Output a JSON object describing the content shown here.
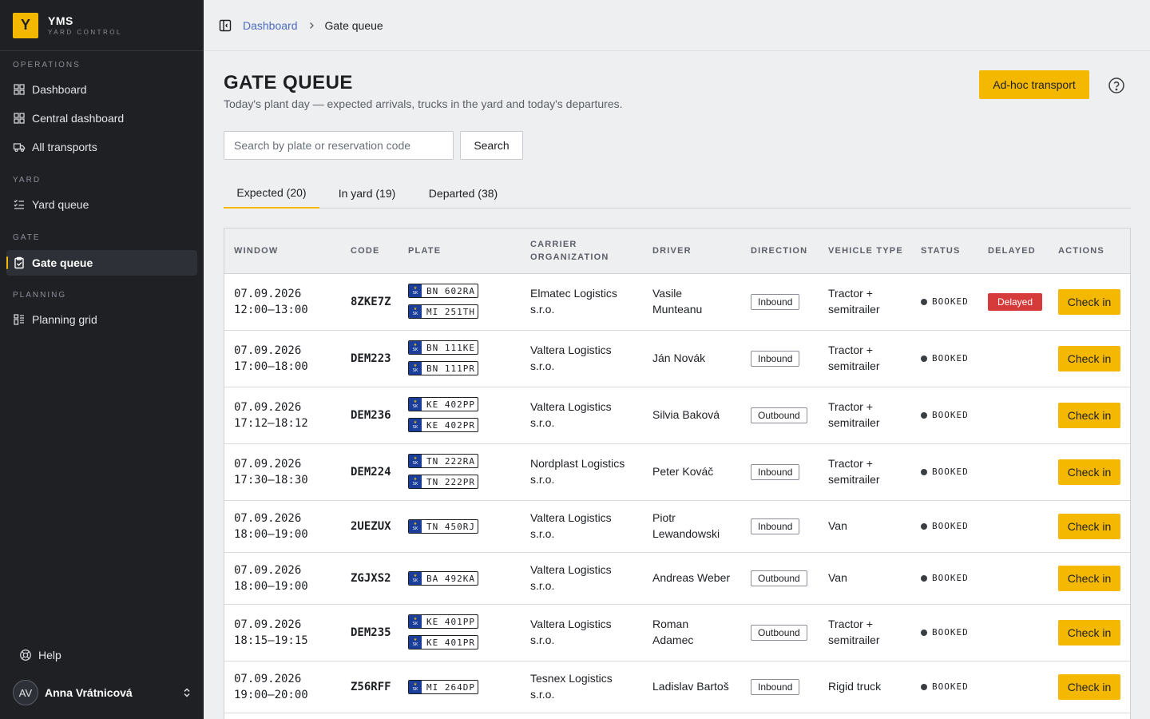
{
  "brand": {
    "logo": "Y",
    "name": "YMS",
    "subtitle": "YARD CONTROL",
    "accent": "#f5b800"
  },
  "sidebar": {
    "sections": [
      {
        "label": "OPERATIONS",
        "items": [
          {
            "label": "Dashboard",
            "icon": "grid-icon"
          },
          {
            "label": "Central dashboard",
            "icon": "grid-icon"
          },
          {
            "label": "All transports",
            "icon": "truck-icon"
          }
        ]
      },
      {
        "label": "YARD",
        "items": [
          {
            "label": "Yard queue",
            "icon": "list-check-icon"
          }
        ]
      },
      {
        "label": "GATE",
        "items": [
          {
            "label": "Gate queue",
            "icon": "clipboard-check-icon",
            "active": true
          }
        ]
      },
      {
        "label": "PLANNING",
        "items": [
          {
            "label": "Planning grid",
            "icon": "layout-icon"
          }
        ]
      }
    ],
    "help": "Help",
    "user": {
      "initials": "AV",
      "name": "Anna Vrátnicová"
    }
  },
  "breadcrumb": {
    "parent": "Dashboard",
    "current": "Gate queue"
  },
  "page": {
    "title": "GATE QUEUE",
    "subtitle": "Today's plant day — expected arrivals, trucks in the yard and today's departures.",
    "adhoc_label": "Ad-hoc transport"
  },
  "search": {
    "placeholder": "Search by plate or reservation code",
    "value": "",
    "button": "Search"
  },
  "tabs": [
    {
      "label": "Expected (20)",
      "active": true
    },
    {
      "label": "In yard (19)"
    },
    {
      "label": "Departed (38)"
    }
  ],
  "table": {
    "headers": {
      "window": "WINDOW",
      "code": "CODE",
      "plate": "PLATE",
      "carrier_1": "CARRIER",
      "carrier_2": "ORGANIZATION",
      "driver": "DRIVER",
      "direction": "DIRECTION",
      "vehicle": "VEHICLE TYPE",
      "status": "STATUS",
      "delayed": "DELAYED",
      "actions": "ACTIONS"
    },
    "plate_country": "SK",
    "rows": [
      {
        "date": "07.09.2026",
        "time": "12:00–13:00",
        "code": "8ZKE7Z",
        "plates": [
          "BN 602RA",
          "MI 251TH"
        ],
        "carrier_1": "Elmatec Logistics",
        "carrier_2": "s.r.o.",
        "driver_1": "Vasile",
        "driver_2": "Munteanu",
        "direction": "Inbound",
        "vehicle_1": "Tractor +",
        "vehicle_2": "semitrailer",
        "status": "BOOKED",
        "delayed": "Delayed",
        "action": "Check in"
      },
      {
        "date": "07.09.2026",
        "time": "17:00–18:00",
        "code": "DEM223",
        "plates": [
          "BN 111KE",
          "BN 111PR"
        ],
        "carrier_1": "Valtera Logistics",
        "carrier_2": "s.r.o.",
        "driver_1": "Ján Novák",
        "driver_2": "",
        "direction": "Inbound",
        "vehicle_1": "Tractor +",
        "vehicle_2": "semitrailer",
        "status": "BOOKED",
        "delayed": "",
        "action": "Check in"
      },
      {
        "date": "07.09.2026",
        "time": "17:12–18:12",
        "code": "DEM236",
        "plates": [
          "KE 402PP",
          "KE 402PR"
        ],
        "carrier_1": "Valtera Logistics",
        "carrier_2": "s.r.o.",
        "driver_1": "Silvia Baková",
        "driver_2": "",
        "direction": "Outbound",
        "vehicle_1": "Tractor +",
        "vehicle_2": "semitrailer",
        "status": "BOOKED",
        "delayed": "",
        "action": "Check in"
      },
      {
        "date": "07.09.2026",
        "time": "17:30–18:30",
        "code": "DEM224",
        "plates": [
          "TN 222RA",
          "TN 222PR"
        ],
        "carrier_1": "Nordplast Logistics",
        "carrier_2": "s.r.o.",
        "driver_1": "Peter Kováč",
        "driver_2": "",
        "direction": "Inbound",
        "vehicle_1": "Tractor +",
        "vehicle_2": "semitrailer",
        "status": "BOOKED",
        "delayed": "",
        "action": "Check in"
      },
      {
        "date": "07.09.2026",
        "time": "18:00–19:00",
        "code": "2UEZUX",
        "plates": [
          "TN 450RJ"
        ],
        "carrier_1": "Valtera Logistics",
        "carrier_2": "s.r.o.",
        "driver_1": "Piotr",
        "driver_2": "Lewandowski",
        "direction": "Inbound",
        "vehicle_1": "Van",
        "vehicle_2": "",
        "status": "BOOKED",
        "delayed": "",
        "action": "Check in"
      },
      {
        "date": "07.09.2026",
        "time": "18:00–19:00",
        "code": "ZGJXS2",
        "plates": [
          "BA 492KA"
        ],
        "carrier_1": "Valtera Logistics",
        "carrier_2": "s.r.o.",
        "driver_1": "Andreas Weber",
        "driver_2": "",
        "direction": "Outbound",
        "vehicle_1": "Van",
        "vehicle_2": "",
        "status": "BOOKED",
        "delayed": "",
        "action": "Check in"
      },
      {
        "date": "07.09.2026",
        "time": "18:15–19:15",
        "code": "DEM235",
        "plates": [
          "KE 401PP",
          "KE 401PR"
        ],
        "carrier_1": "Valtera Logistics",
        "carrier_2": "s.r.o.",
        "driver_1": "Roman",
        "driver_2": "Adamec",
        "direction": "Outbound",
        "vehicle_1": "Tractor +",
        "vehicle_2": "semitrailer",
        "status": "BOOKED",
        "delayed": "",
        "action": "Check in"
      },
      {
        "date": "07.09.2026",
        "time": "19:00–20:00",
        "code": "Z56RFF",
        "plates": [
          "MI 264DP"
        ],
        "carrier_1": "Tesnex Logistics",
        "carrier_2": "s.r.o.",
        "driver_1": "Ladislav Bartoš",
        "driver_2": "",
        "direction": "Inbound",
        "vehicle_1": "Rigid truck",
        "vehicle_2": "",
        "status": "BOOKED",
        "delayed": "",
        "action": "Check in"
      }
    ]
  }
}
